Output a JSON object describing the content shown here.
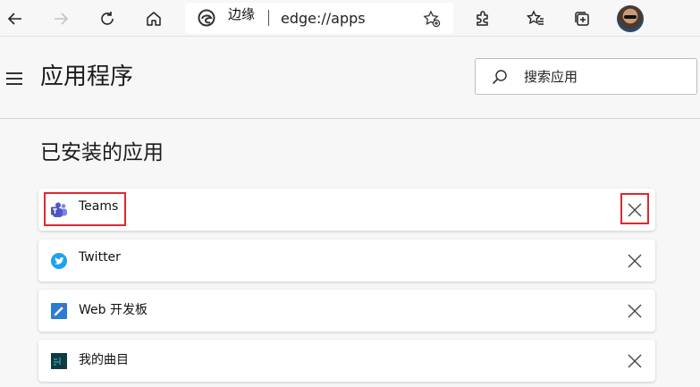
{
  "toolbar": {
    "site_name": "边缘",
    "url": "edge://apps",
    "icons": [
      "back-icon",
      "forward-icon",
      "refresh-icon",
      "home-icon",
      "edge-icon",
      "add-favorite-icon",
      "extensions-icon",
      "favorites-icon",
      "collections-icon",
      "profile-avatar"
    ]
  },
  "header": {
    "title": "应用程序",
    "search_placeholder": "搜索应用"
  },
  "section": {
    "title": "已安装的应用"
  },
  "apps": [
    {
      "name": "Teams",
      "icon": "teams-icon",
      "color": "#5059c9"
    },
    {
      "name": "Twitter",
      "icon": "twitter-icon",
      "color": "#1da1f2"
    },
    {
      "name": "Web 开发板",
      "icon": "webboard-icon",
      "color": "#2b7cd3"
    },
    {
      "name": "我的曲目",
      "icon": "mytracks-icon",
      "color": "#0f3a44"
    }
  ],
  "colors": {
    "highlight": "#e0282e",
    "background": "#f7f7f7"
  }
}
